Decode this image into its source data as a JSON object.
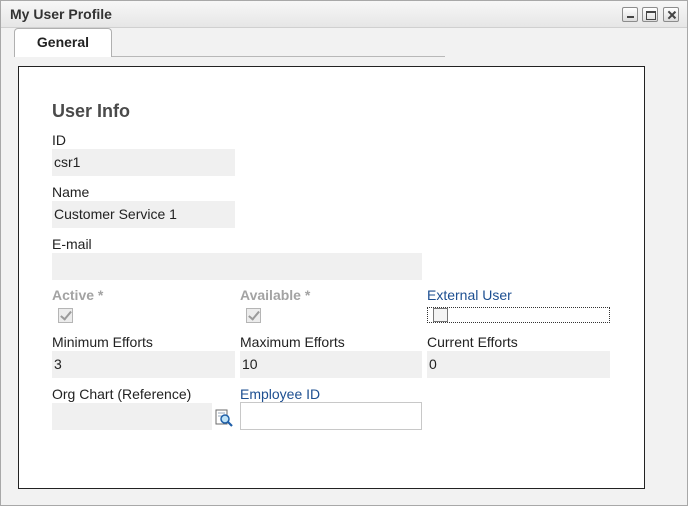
{
  "window": {
    "title": "My User Profile"
  },
  "tabs": [
    {
      "label": "General",
      "selected": true
    }
  ],
  "section": {
    "title": "User Info"
  },
  "fields": {
    "id": {
      "label": "ID",
      "value": "csr1"
    },
    "name": {
      "label": "Name",
      "value": "Customer Service 1"
    },
    "email": {
      "label": "E-mail",
      "value": ""
    },
    "active": {
      "label": "Active *",
      "checked": true
    },
    "available": {
      "label": "Available *",
      "checked": true
    },
    "external_user": {
      "label": "External User",
      "checked": false
    },
    "min_efforts": {
      "label": "Minimum Efforts",
      "value": "3"
    },
    "max_efforts": {
      "label": "Maximum Efforts",
      "value": "10"
    },
    "current_efforts": {
      "label": "Current Efforts",
      "value": "0"
    },
    "org_chart": {
      "label": "Org Chart (Reference)",
      "value": ""
    },
    "employee_id": {
      "label": "Employee ID",
      "value": ""
    }
  },
  "icons": {
    "minimize": "minimize-icon",
    "maximize": "maximize-icon",
    "close": "close-icon",
    "lookup": "lookup-search-icon"
  }
}
